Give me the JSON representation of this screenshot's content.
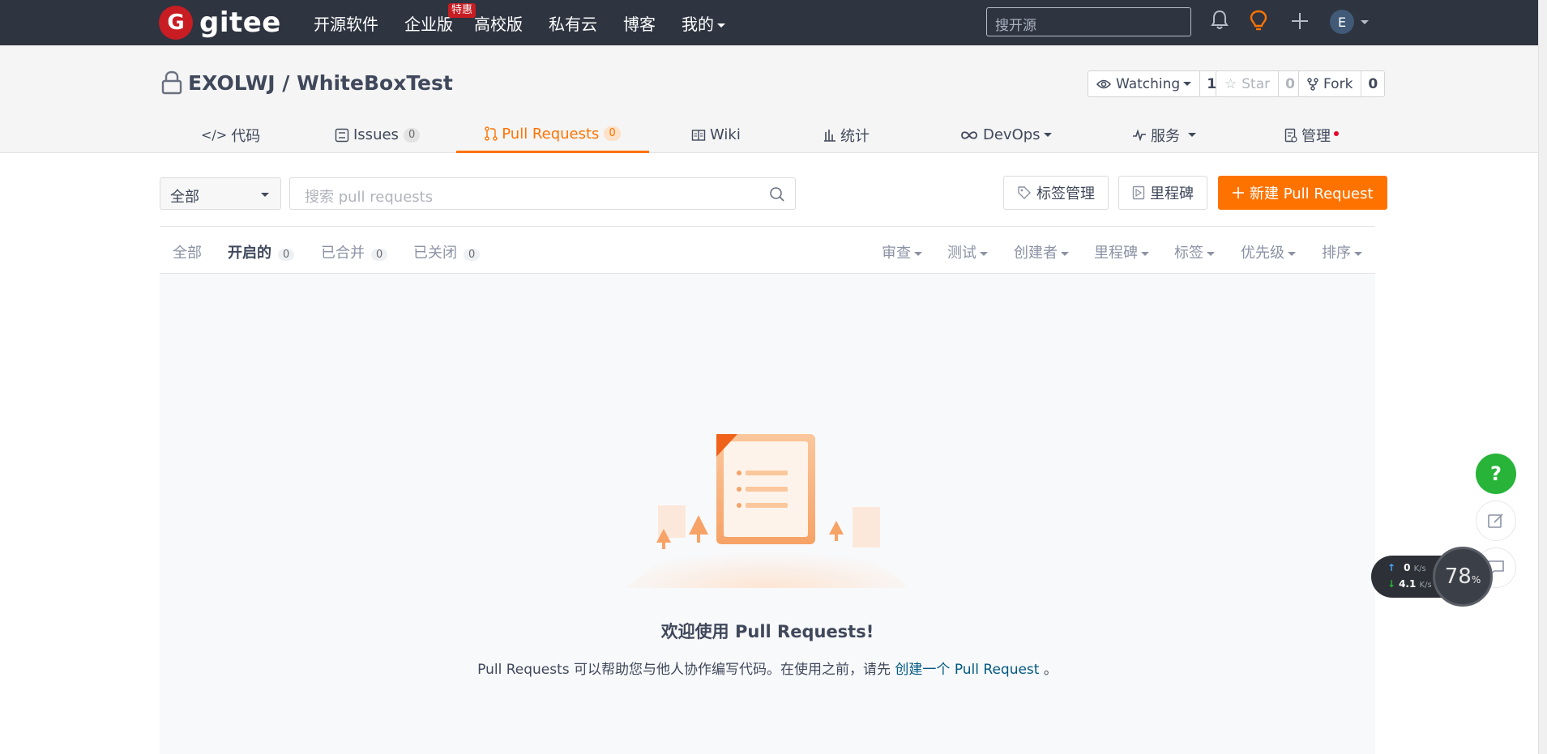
{
  "topbar": {
    "logo_text": "gitee",
    "logo_glyph": "G",
    "nav": [
      {
        "label": "开源软件"
      },
      {
        "label": "企业版",
        "badge": "特惠"
      },
      {
        "label": "高校版"
      },
      {
        "label": "私有云"
      },
      {
        "label": "博客"
      },
      {
        "label": "我的"
      }
    ],
    "search_placeholder": "搜开源",
    "avatar_initial": "E",
    "bg_color": "#2e3440"
  },
  "repo": {
    "title": "EXOLWJ / WhiteBoxTest",
    "watching_label": "Watching",
    "watching_count": "1",
    "star_label": "Star",
    "star_count": "0",
    "fork_label": "Fork",
    "fork_count": "0"
  },
  "tabs": [
    {
      "label": "代码",
      "icon": "code-icon"
    },
    {
      "label": "Issues",
      "count": "0",
      "icon": "issues-icon"
    },
    {
      "label": "Pull Requests",
      "count": "0",
      "icon": "pull-request-icon"
    },
    {
      "label": "Wiki",
      "icon": "book-icon"
    },
    {
      "label": "统计",
      "icon": "bar-chart-icon"
    },
    {
      "label": "DevOps",
      "icon": "infinity-icon"
    },
    {
      "label": "服务",
      "icon": "pulse-icon"
    },
    {
      "label": "管理",
      "icon": "manage-icon"
    }
  ],
  "toolbar": {
    "filter_value": "全部",
    "search_placeholder": "搜索 pull requests",
    "label_manage": "标签管理",
    "milestone": "里程碑",
    "new_pr": "新建 Pull Request"
  },
  "state_tabs": [
    {
      "label": "全部"
    },
    {
      "label": "开启的",
      "count": "0"
    },
    {
      "label": "已合并",
      "count": "0"
    },
    {
      "label": "已关闭",
      "count": "0"
    }
  ],
  "filters": [
    "审查",
    "测试",
    "创建者",
    "里程碑",
    "标签",
    "优先级",
    "排序"
  ],
  "empty": {
    "title": "欢迎使用 Pull Requests!",
    "desc_before": "Pull Requests 可以帮助您与他人协作编写代码。在使用之前，请先 ",
    "desc_link": "创建一个 Pull Request",
    "desc_after": " 。"
  },
  "float": {
    "help": "?",
    "upload_speed": "0",
    "upload_unit": "K/s",
    "download_speed": "4.1",
    "download_unit": "K/s",
    "gauge_value": "78",
    "gauge_unit": "%"
  },
  "colors": {
    "accent": "#fe7300",
    "brand": "#c71d23",
    "help_green": "#27b439",
    "link": "#005980"
  }
}
